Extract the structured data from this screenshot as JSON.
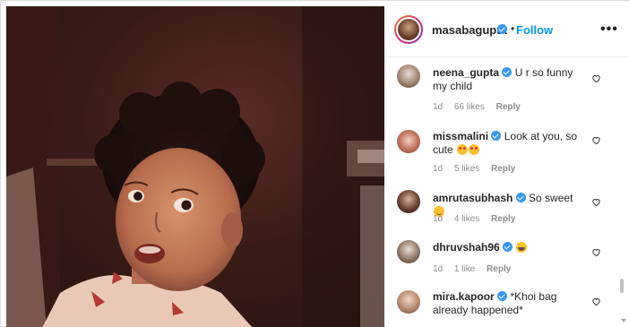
{
  "post": {
    "image_alt": "vintage photo of a curly-haired child",
    "author": "masabagupta",
    "follow_label": "Follow",
    "separator": "•",
    "more_label": "•••"
  },
  "comments": [
    {
      "user": "neena_gupta",
      "verified": true,
      "text": "U r so funny my child",
      "emojis": [],
      "age": "1d",
      "likes": "66 likes",
      "reply": "Reply"
    },
    {
      "user": "missmalini",
      "verified": true,
      "text": "Look at you, so cute",
      "emojis": [
        "heart-eyes-emoji",
        "heart-eyes-emoji"
      ],
      "age": "1d",
      "likes": "5 likes",
      "reply": "Reply"
    },
    {
      "user": "amrutasubhash",
      "verified": true,
      "text": "So sweet",
      "emojis": [
        "winking-tongue-emoji"
      ],
      "age": "1d",
      "likes": "4 likes",
      "reply": "Reply"
    },
    {
      "user": "dhruvshah96",
      "verified": true,
      "text": "",
      "emojis": [
        "grinning-sweat-emoji"
      ],
      "age": "1d",
      "likes": "1 like",
      "reply": "Reply"
    },
    {
      "user": "mira.kapoor",
      "verified": true,
      "text": "*Khoi bag already happened*",
      "emojis": [],
      "age": "",
      "likes": "",
      "reply": ""
    }
  ],
  "colors": {
    "link_blue": "#0095f6",
    "verified_blue": "#3897f0",
    "meta_gray": "#8e8e8e",
    "text": "#262626"
  },
  "icons": [
    "verified-badge-icon",
    "heart-outline-icon",
    "more-options-icon"
  ]
}
